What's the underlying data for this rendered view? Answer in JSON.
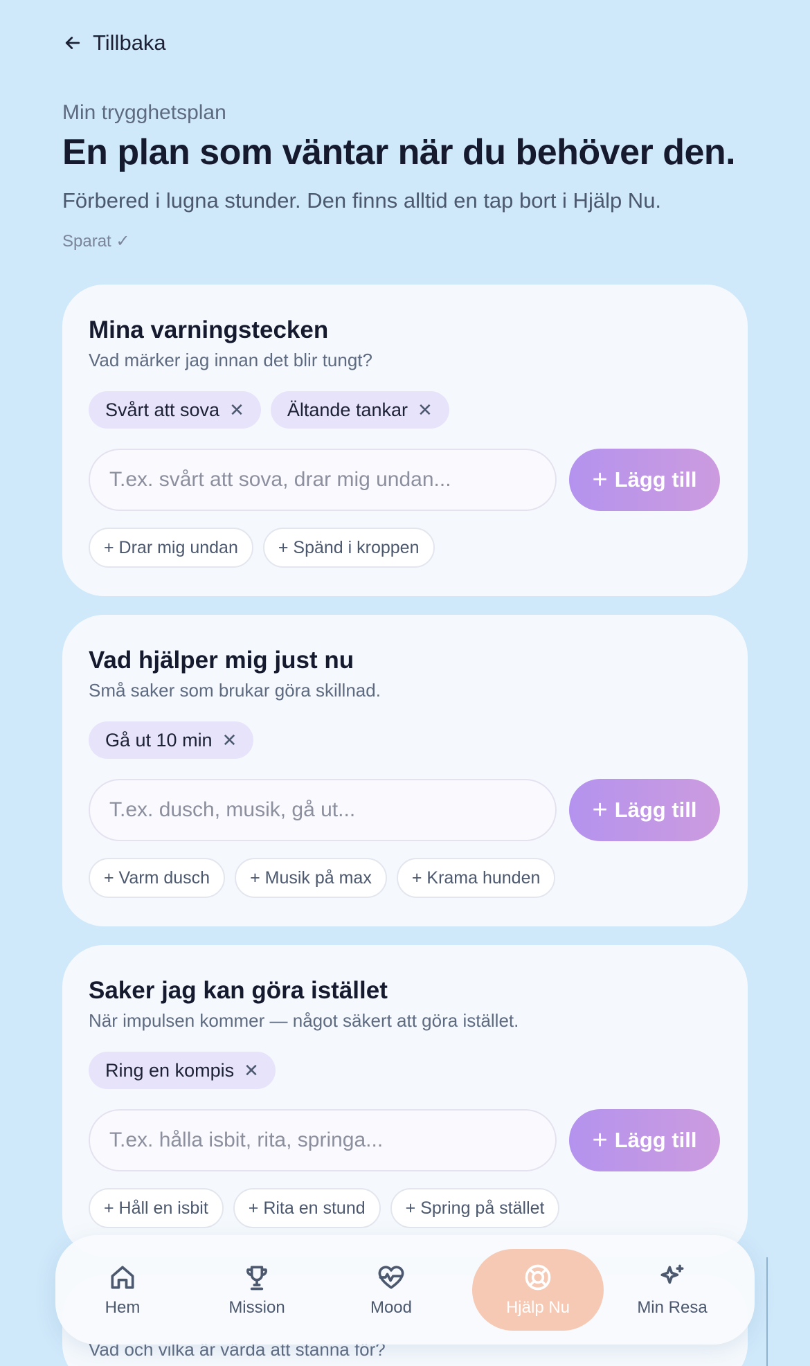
{
  "back": {
    "label": "Tillbaka"
  },
  "header": {
    "eyebrow": "Min trygghetsplan",
    "title": "En plan som väntar när du behöver den.",
    "subtitle": "Förbered i lugna stunder. Den finns alltid en tap bort i Hjälp Nu.",
    "saved_status": "Sparat ✓"
  },
  "sections": [
    {
      "title": "Mina varningstecken",
      "description": "Vad märker jag innan det blir tungt?",
      "chips": [
        "Svårt att sova",
        "Ältande tankar"
      ],
      "input_placeholder": "T.ex. svårt att sova, drar mig undan...",
      "add_label": "Lägg till",
      "suggestions": [
        "+ Drar mig undan",
        "+ Spänd i kroppen"
      ]
    },
    {
      "title": "Vad hjälper mig just nu",
      "description": "Små saker som brukar göra skillnad.",
      "chips": [
        "Gå ut 10 min"
      ],
      "input_placeholder": "T.ex. dusch, musik, gå ut...",
      "add_label": "Lägg till",
      "suggestions": [
        "+ Varm dusch",
        "+ Musik på max",
        "+ Krama hunden"
      ]
    },
    {
      "title": "Saker jag kan göra istället",
      "description": "När impulsen kommer — något säkert att göra istället.",
      "chips": [
        "Ring en kompis"
      ],
      "input_placeholder": "T.ex. hålla isbit, rita, springa...",
      "add_label": "Lägg till",
      "suggestions": [
        "+ Håll en isbit",
        "+ Rita en stund",
        "+ Spring på stället"
      ]
    }
  ],
  "next_section_peek": {
    "description": "Vad och vilka är värda att stanna för?"
  },
  "nav": {
    "items": [
      {
        "label": "Hem",
        "icon": "home-icon"
      },
      {
        "label": "Mission",
        "icon": "trophy-icon"
      },
      {
        "label": "Mood",
        "icon": "heart-pulse-icon"
      },
      {
        "label": "Hjälp Nu",
        "icon": "lifebuoy-icon",
        "active": true
      },
      {
        "label": "Min Resa",
        "icon": "sparkles-icon"
      }
    ],
    "active_color": "#f6c9b4"
  },
  "colors": {
    "background": "#cfe8fa",
    "card": "#f5f9fd",
    "chip": "#e6e3fb",
    "accent_gradient_start": "#b493ee",
    "accent_gradient_end": "#cc9bdf"
  }
}
